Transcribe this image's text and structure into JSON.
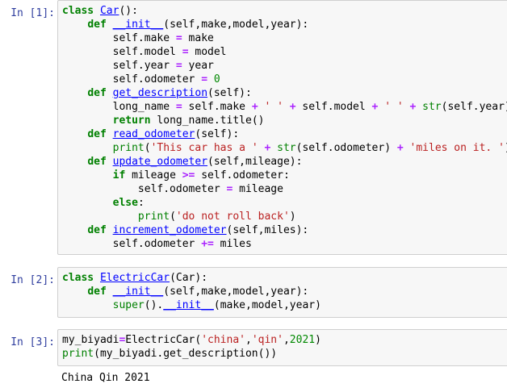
{
  "cells": [
    {
      "prompt": "In [1]:",
      "lines": [
        [
          {
            "t": "class",
            "c": "kw"
          },
          {
            "t": " "
          },
          {
            "t": "Car",
            "c": "cls"
          },
          {
            "t": "():"
          }
        ],
        [
          {
            "t": "    "
          },
          {
            "t": "def",
            "c": "kw"
          },
          {
            "t": " "
          },
          {
            "t": "__init__",
            "c": "fn"
          },
          {
            "t": "(self,make,model,year):"
          }
        ],
        [
          {
            "t": "        self.make "
          },
          {
            "t": "=",
            "c": "op"
          },
          {
            "t": " make"
          }
        ],
        [
          {
            "t": "        self.model "
          },
          {
            "t": "=",
            "c": "op"
          },
          {
            "t": " model"
          }
        ],
        [
          {
            "t": "        self.year "
          },
          {
            "t": "=",
            "c": "op"
          },
          {
            "t": " year"
          }
        ],
        [
          {
            "t": "        self.odometer "
          },
          {
            "t": "=",
            "c": "op"
          },
          {
            "t": " "
          },
          {
            "t": "0",
            "c": "num"
          }
        ],
        [
          {
            "t": "    "
          },
          {
            "t": "def",
            "c": "kw"
          },
          {
            "t": " "
          },
          {
            "t": "get_description",
            "c": "fn"
          },
          {
            "t": "(self):"
          }
        ],
        [
          {
            "t": "        long_name "
          },
          {
            "t": "=",
            "c": "op"
          },
          {
            "t": " self.make "
          },
          {
            "t": "+",
            "c": "op"
          },
          {
            "t": " "
          },
          {
            "t": "' '",
            "c": "str"
          },
          {
            "t": " "
          },
          {
            "t": "+",
            "c": "op"
          },
          {
            "t": " self.model "
          },
          {
            "t": "+",
            "c": "op"
          },
          {
            "t": " "
          },
          {
            "t": "' '",
            "c": "str"
          },
          {
            "t": " "
          },
          {
            "t": "+",
            "c": "op"
          },
          {
            "t": " "
          },
          {
            "t": "str",
            "c": "bi"
          },
          {
            "t": "(self.year)"
          }
        ],
        [
          {
            "t": "        "
          },
          {
            "t": "return",
            "c": "kw"
          },
          {
            "t": " long_name.title()"
          }
        ],
        [
          {
            "t": "    "
          },
          {
            "t": "def",
            "c": "kw"
          },
          {
            "t": " "
          },
          {
            "t": "read_odometer",
            "c": "fn"
          },
          {
            "t": "(self):"
          }
        ],
        [
          {
            "t": "        "
          },
          {
            "t": "print",
            "c": "bi"
          },
          {
            "t": "("
          },
          {
            "t": "'This car has a '",
            "c": "str"
          },
          {
            "t": " "
          },
          {
            "t": "+",
            "c": "op"
          },
          {
            "t": " "
          },
          {
            "t": "str",
            "c": "bi"
          },
          {
            "t": "(self.odometer) "
          },
          {
            "t": "+",
            "c": "op"
          },
          {
            "t": " "
          },
          {
            "t": "'miles on it. '",
            "c": "str"
          },
          {
            "t": ")"
          }
        ],
        [
          {
            "t": "    "
          },
          {
            "t": "def",
            "c": "kw"
          },
          {
            "t": " "
          },
          {
            "t": "update_odometer",
            "c": "fn"
          },
          {
            "t": "(self,mileage):"
          }
        ],
        [
          {
            "t": "        "
          },
          {
            "t": "if",
            "c": "kw"
          },
          {
            "t": " mileage "
          },
          {
            "t": ">=",
            "c": "op"
          },
          {
            "t": " self.odometer:"
          }
        ],
        [
          {
            "t": "            self.odometer "
          },
          {
            "t": "=",
            "c": "op"
          },
          {
            "t": " mileage"
          }
        ],
        [
          {
            "t": "        "
          },
          {
            "t": "else",
            "c": "kw"
          },
          {
            "t": ":"
          }
        ],
        [
          {
            "t": "            "
          },
          {
            "t": "print",
            "c": "bi"
          },
          {
            "t": "("
          },
          {
            "t": "'do not roll back'",
            "c": "str"
          },
          {
            "t": ")"
          }
        ],
        [
          {
            "t": "    "
          },
          {
            "t": "def",
            "c": "kw"
          },
          {
            "t": " "
          },
          {
            "t": "increment_odometer",
            "c": "fn"
          },
          {
            "t": "(self,miles):"
          }
        ],
        [
          {
            "t": "        self.odometer "
          },
          {
            "t": "+=",
            "c": "op"
          },
          {
            "t": " miles"
          }
        ]
      ],
      "output": ""
    },
    {
      "prompt": "In [2]:",
      "lines": [
        [
          {
            "t": "class",
            "c": "kw"
          },
          {
            "t": " "
          },
          {
            "t": "ElectricCar",
            "c": "cls"
          },
          {
            "t": "(Car):"
          }
        ],
        [
          {
            "t": "    "
          },
          {
            "t": "def",
            "c": "kw"
          },
          {
            "t": " "
          },
          {
            "t": "__init__",
            "c": "fn"
          },
          {
            "t": "(self,make,model,year):"
          }
        ],
        [
          {
            "t": "        "
          },
          {
            "t": "super",
            "c": "bi"
          },
          {
            "t": "()."
          },
          {
            "t": "__init__",
            "c": "fn"
          },
          {
            "t": "(make,model,year)"
          }
        ]
      ],
      "output": ""
    },
    {
      "prompt": "In [3]:",
      "lines": [
        [
          {
            "t": "my_biyadi"
          },
          {
            "t": "=",
            "c": "op"
          },
          {
            "t": "ElectricCar("
          },
          {
            "t": "'china'",
            "c": "str"
          },
          {
            "t": ","
          },
          {
            "t": "'qin'",
            "c": "str"
          },
          {
            "t": ","
          },
          {
            "t": "2021",
            "c": "num"
          },
          {
            "t": ")"
          }
        ],
        [
          {
            "t": "print",
            "c": "bi"
          },
          {
            "t": "(my_biyadi.get_description())"
          }
        ]
      ],
      "output": "China Qin 2021"
    }
  ]
}
